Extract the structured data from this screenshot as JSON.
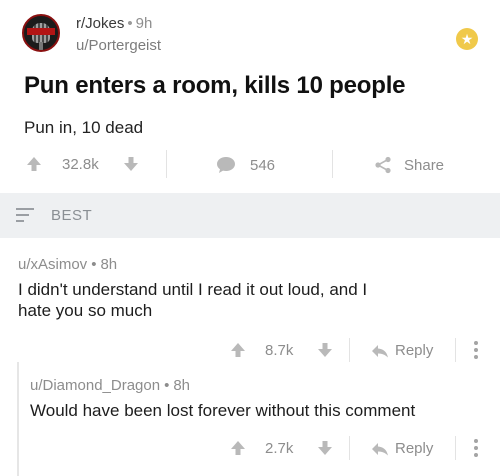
{
  "post": {
    "subreddit": "r/Jokes",
    "separator": "•",
    "time": "9h",
    "author": "u/Portergeist",
    "title": "Pun enters a room, kills 10 people",
    "body": "Pun in, 10 dead",
    "score": "32.8k",
    "comments_count": "546",
    "share_label": "Share"
  },
  "sort": {
    "label": "BEST"
  },
  "comments": [
    {
      "author": "u/xAsimov",
      "time": "8h",
      "body_line1": "I didn't understand until I read it out loud, and I",
      "body_line2": "hate you so much",
      "score": "8.7k",
      "reply_label": "Reply"
    },
    {
      "author": "u/Diamond_Dragon",
      "time": "8h",
      "body_line1": "Would have been lost forever without this comment",
      "score": "2.7k",
      "reply_label": "Reply"
    }
  ],
  "colors": {
    "award": "#f0c94a",
    "sort_bar_bg": "#eef0f2",
    "meta_gray": "#8d8d8d"
  }
}
